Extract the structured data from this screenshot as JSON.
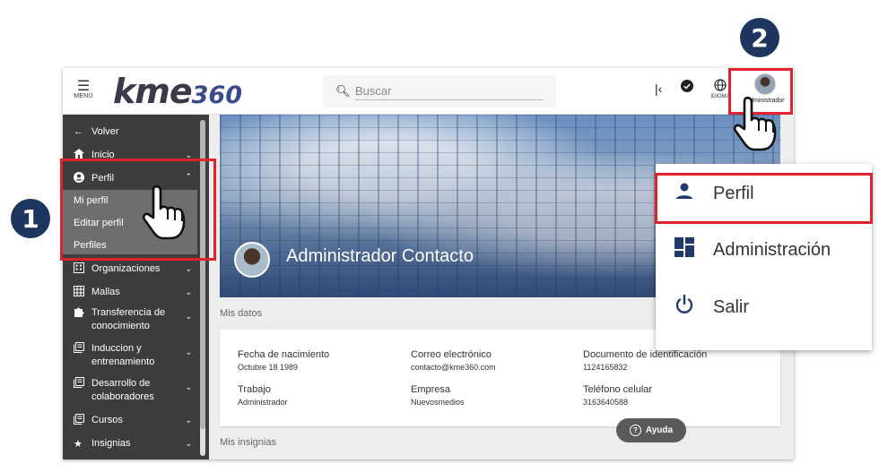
{
  "header": {
    "menu_label": "MENÚ",
    "logo_text": "kme",
    "logo_number": "360",
    "search_placeholder": "Buscar",
    "lang_label": "IDIOMA",
    "user_label": "Administrador"
  },
  "sidebar": {
    "back": "Volver",
    "items": [
      {
        "label": "Inicio",
        "icon": "home-icon"
      },
      {
        "label": "Perfil",
        "icon": "user-circle-icon"
      },
      {
        "label": "Organizaciones",
        "icon": "building-icon"
      },
      {
        "label": "Mallas",
        "icon": "grid-icon"
      },
      {
        "label": "Transferencia de conocimiento",
        "icon": "puzzle-icon"
      },
      {
        "label": "Induccion y entrenamiento",
        "icon": "book-icon"
      },
      {
        "label": "Desarrollo de colaboradores",
        "icon": "book-icon"
      },
      {
        "label": "Cursos",
        "icon": "book-icon"
      },
      {
        "label": "Insignias",
        "icon": "star-icon"
      }
    ],
    "transfer_l1": "Transferencia de",
    "transfer_l2": "conocimiento",
    "induccion_l1": "Induccion y",
    "induccion_l2": "entrenamiento",
    "desarrollo_l1": "Desarrollo de",
    "desarrollo_l2": "colaboradores",
    "perfil_sub": [
      "Mi perfil",
      "Editar perfil",
      "Perfiles"
    ]
  },
  "profile": {
    "name": "Administrador Contacto",
    "section_data": "Mis datos",
    "section_badges": "Mis insignias",
    "fields": [
      {
        "label": "Fecha de nacimiento",
        "value": "Octubre 18 1989"
      },
      {
        "label": "Correo electrónico",
        "value": "contacto@kme360.com"
      },
      {
        "label": "Documento de identificación",
        "value": "1124165832"
      },
      {
        "label": "Trabajo",
        "value": "Administrador"
      },
      {
        "label": "Empresa",
        "value": "Nuevosmedios"
      },
      {
        "label": "Teléfono celular",
        "value": "3163640588"
      }
    ]
  },
  "help_label": "Ayuda",
  "dropdown": {
    "items": [
      {
        "label": "Perfil",
        "icon": "person-icon"
      },
      {
        "label": "Administración",
        "icon": "dashboard-icon"
      },
      {
        "label": "Salir",
        "icon": "power-icon"
      }
    ]
  },
  "badges": {
    "one": "1",
    "two": "2"
  },
  "colors": {
    "highlight": "#e0232b",
    "badge": "#1e3560",
    "sidebar": "#3d3d3d",
    "icon_accent": "#213a6b"
  }
}
